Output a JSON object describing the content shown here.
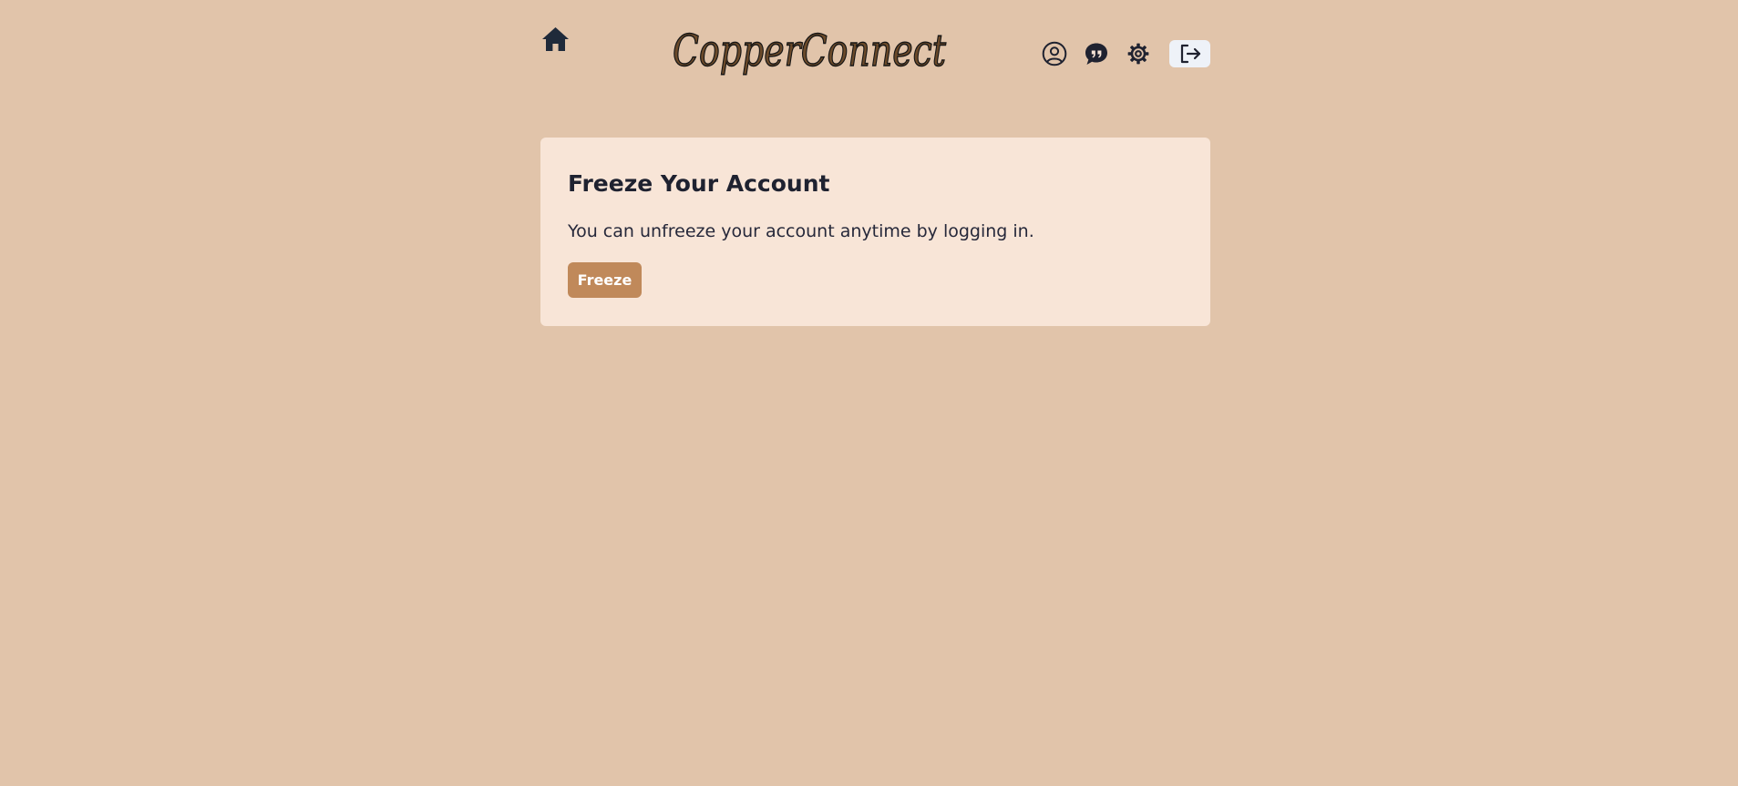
{
  "app": {
    "logo_text": "CopperConnect"
  },
  "header": {
    "home_icon": "home-icon",
    "nav": [
      {
        "name": "profile",
        "icon": "user-circle-icon"
      },
      {
        "name": "chat",
        "icon": "quote-bubble-icon"
      },
      {
        "name": "settings",
        "icon": "gear-icon"
      },
      {
        "name": "logout",
        "icon": "logout-arrow-icon"
      }
    ]
  },
  "card": {
    "title": "Freeze Your Account",
    "description": "You can unfreeze your account anytime by logging in.",
    "button_label": "Freeze"
  },
  "colors": {
    "page_background": "#e1c4aa",
    "card_background": "#f8e5d7",
    "accent_button": "#c0895a",
    "logout_button_background": "#eef2f8",
    "text": "#1f2230"
  }
}
